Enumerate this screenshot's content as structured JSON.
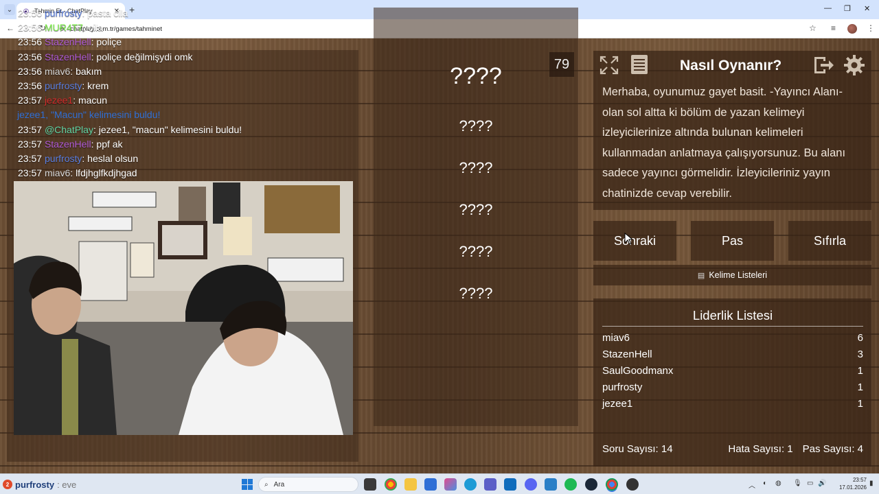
{
  "browser": {
    "tab_title": "Tahmin Et - ChatPlay",
    "url": "chatplay.com.tr/games/tahminet"
  },
  "chat": {
    "messages": [
      {
        "time": "23:56",
        "user": "purfrosty",
        "color": "#5b7fe0",
        "text": ": pasta cila"
      },
      {
        "time": "23:56",
        "user": "MUR4T7",
        "color": "#7ff24d",
        "text": ": cila"
      },
      {
        "time": "23:56",
        "user": "StazenHell",
        "color": "#b05bd6",
        "text": ": poliçe"
      },
      {
        "time": "23:56",
        "user": "StazenHell",
        "color": "#b05bd6",
        "text": ": poliçe değilmişydi omk"
      },
      {
        "time": "23:56",
        "user": "miav6",
        "color": "#d8d8d8",
        "text": ": bakım"
      },
      {
        "time": "23:56",
        "user": "purfrosty",
        "color": "#5b7fe0",
        "text": ": krem"
      },
      {
        "time": "23:57",
        "user": "jezee1",
        "color": "#d32b2b",
        "text": ": macun"
      },
      {
        "notice": "jezee1, \"Macun\" kelimesini buldu!"
      },
      {
        "time": "23:57",
        "user": "@ChatPlay",
        "color": "#62d6a6",
        "text": ": jezee1, \"macun\" kelimesini buldu!"
      },
      {
        "time": "23:57",
        "user": "StazenHell",
        "color": "#b05bd6",
        "text": ": ppf ak"
      },
      {
        "time": "23:57",
        "user": "purfrosty",
        "color": "#5b7fe0",
        "text": ": heslal olsun"
      },
      {
        "time": "23:57",
        "user": "miav6",
        "color": "#d8d8d8",
        "text": ": lfdjhglfkdjhgad"
      }
    ]
  },
  "game": {
    "remaining": "79",
    "words": [
      "????",
      "????",
      "????",
      "????",
      "????",
      "????"
    ]
  },
  "info": {
    "title": "Nasıl Oynanır?",
    "body": "Merhaba, oyunumuz gayet basit. -Yayıncı Alanı- olan sol altta ki bölüm de yazan kelimeyi izleyicilerinize altında bulunan kelimeleri kullanmadan anlatmaya çalışıyorsunuz. Bu alanı sadece yayıncı görmelidir. İzleyicileriniz yayın chatinizde cevap verebilir."
  },
  "actions": {
    "next": "Sonraki",
    "pass": "Pas",
    "reset": "Sıfırla",
    "word_lists": "Kelime Listeleri"
  },
  "leaderboard": {
    "title": "Liderlik Listesi",
    "rows": [
      {
        "name": "miav6",
        "score": "6"
      },
      {
        "name": "StazenHell",
        "score": "3"
      },
      {
        "name": "SaulGoodmanx",
        "score": "1"
      },
      {
        "name": "purfrosty",
        "score": "1"
      },
      {
        "name": "jezee1",
        "score": "1"
      }
    ],
    "questions": "Soru Sayısı: 14",
    "errors": "Hata Sayısı: 1",
    "passes": "Pas Sayısı: 4"
  },
  "taskbar": {
    "widget_badge": "2",
    "widget_user": "purfrosty",
    "widget_tail": ": eve",
    "search_placeholder": "Ara",
    "time": "23:57",
    "date": "17.01.2026"
  }
}
